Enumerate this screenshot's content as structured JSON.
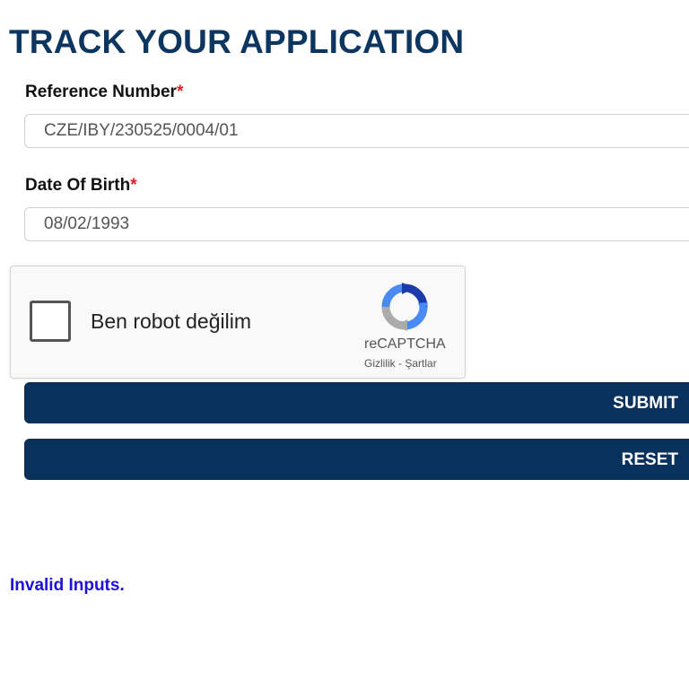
{
  "page": {
    "title": "TRACK YOUR APPLICATION"
  },
  "form": {
    "reference": {
      "label": "Reference Number",
      "required_mark": "*",
      "value": "CZE/IBY/230525/0004/01"
    },
    "dob": {
      "label": "Date Of Birth",
      "required_mark": "*",
      "value": "08/02/1993"
    },
    "captcha": {
      "checkbox_label": "Ben robot değilim",
      "brand": "reCAPTCHA",
      "privacy_link": "Gizlilik",
      "separator": "-",
      "terms_link": "Şartlar",
      "checked": false
    },
    "buttons": {
      "submit_label": "SUBMIT",
      "reset_label": "RESET"
    },
    "message": "Invalid Inputs."
  },
  "colors": {
    "title": "#0c355f",
    "button_bg": "#08315d",
    "required": "#e01b24",
    "message": "#1d12d6"
  },
  "icons": {
    "captcha_logo": "recaptcha-logo-icon"
  }
}
